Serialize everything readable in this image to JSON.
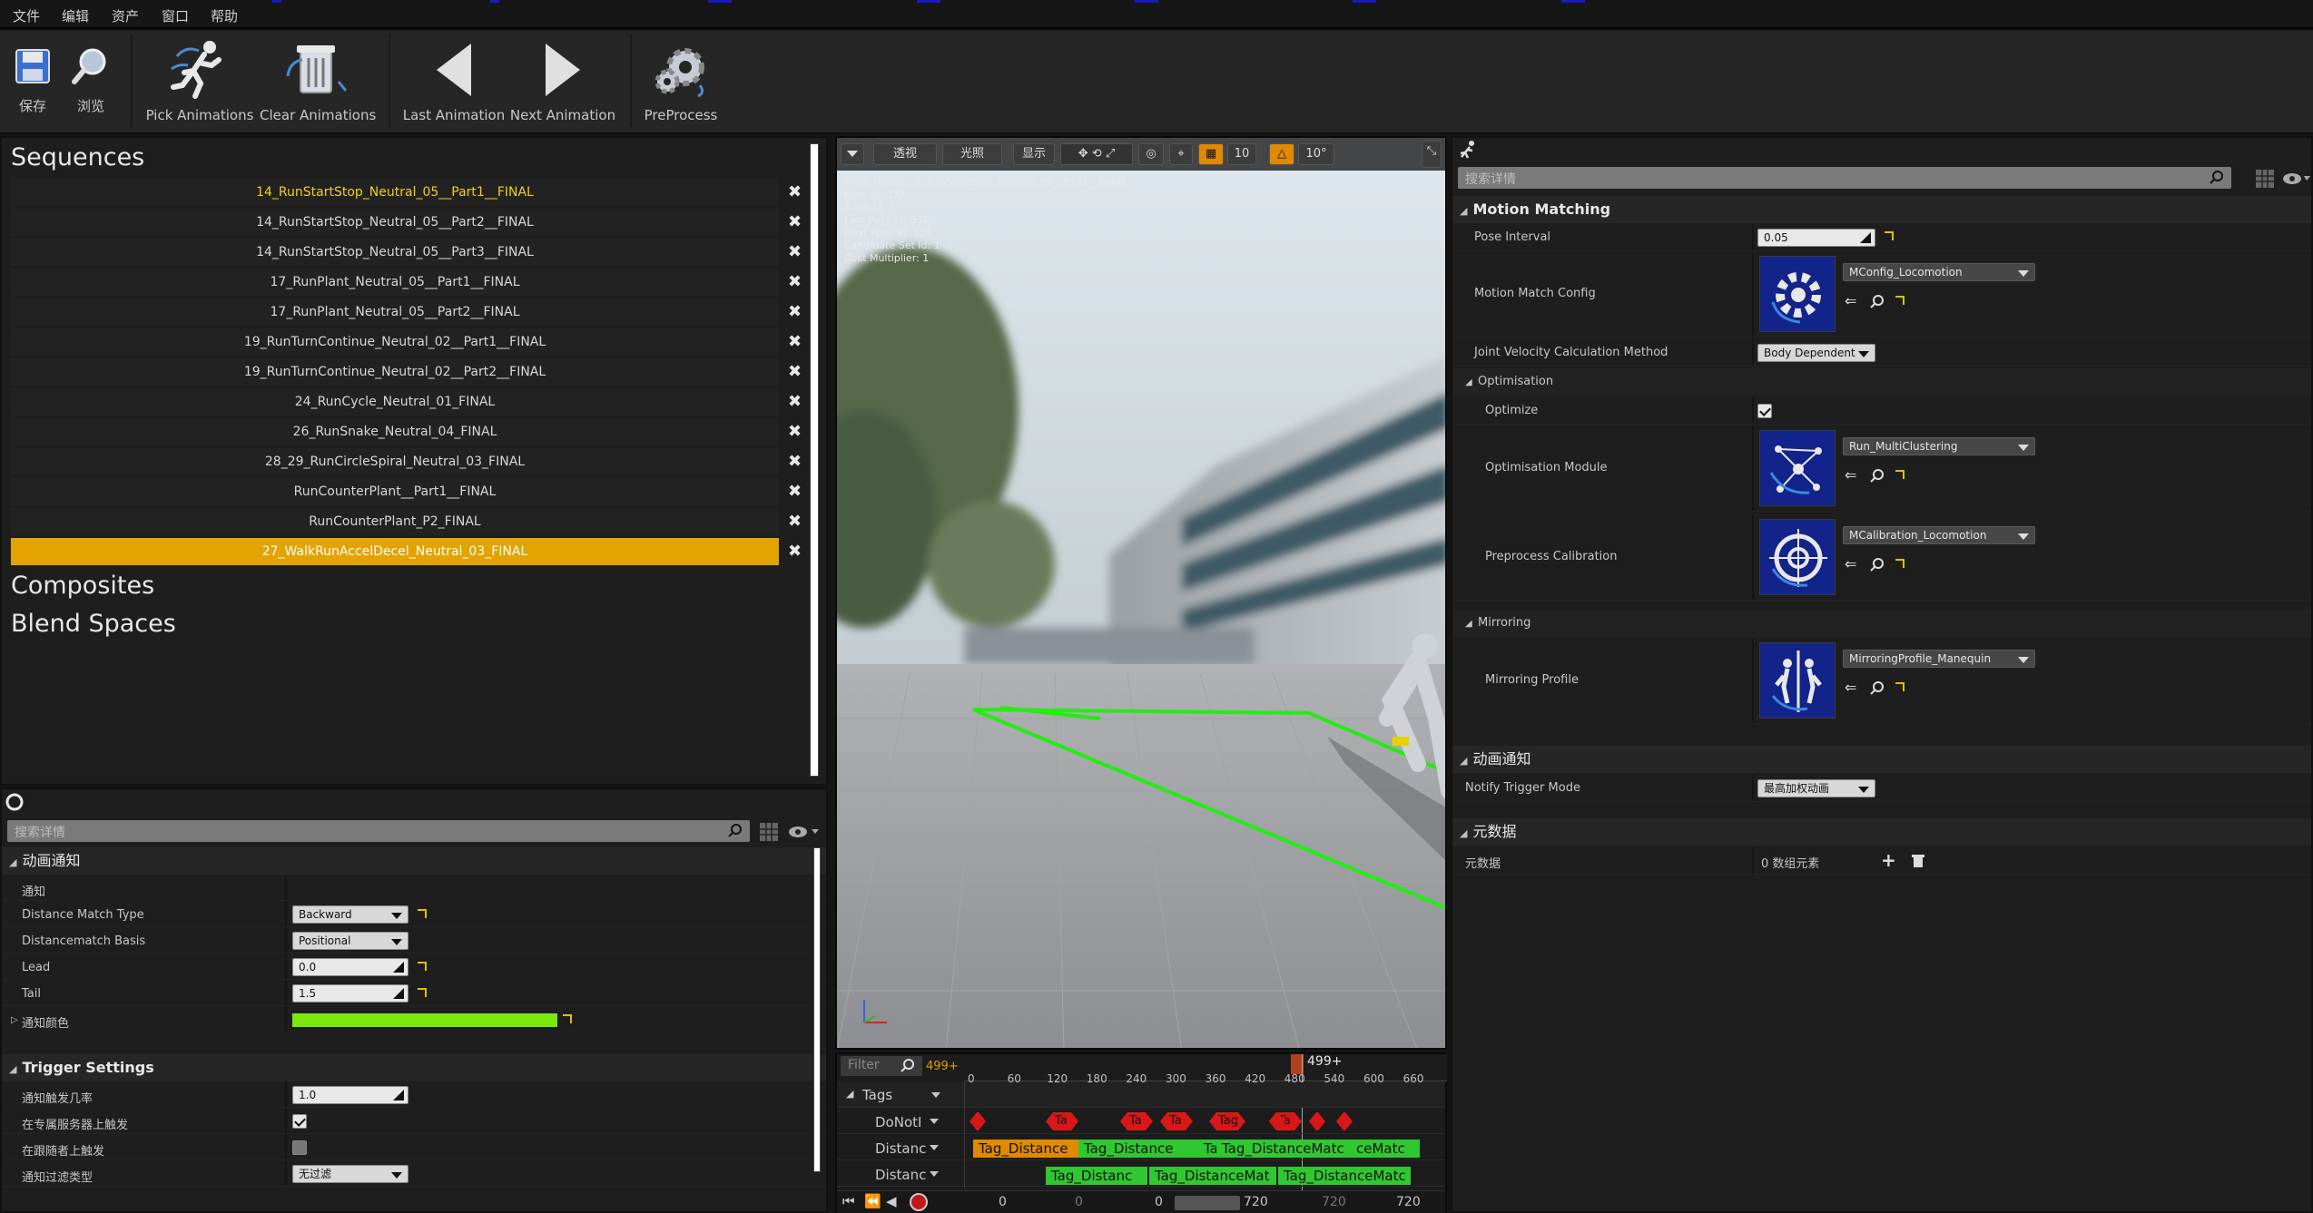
{
  "menu": [
    "文件",
    "编辑",
    "资产",
    "窗口",
    "帮助"
  ],
  "toolbar": {
    "save": "保存",
    "browse": "浏览",
    "pick": "Pick Animations",
    "clear": "Clear Animations",
    "last": "Last Animation",
    "next": "Next Animation",
    "preprocess": "PreProcess"
  },
  "sequences": {
    "title": "Sequences",
    "items": [
      "14_RunStartStop_Neutral_05__Part1__FINAL",
      "14_RunStartStop_Neutral_05__Part2__FINAL",
      "14_RunStartStop_Neutral_05__Part3__FINAL",
      "17_RunPlant_Neutral_05__Part1__FINAL",
      "17_RunPlant_Neutral_05__Part2__FINAL",
      "19_RunTurnContinue_Neutral_02__Part1__FINAL",
      "19_RunTurnContinue_Neutral_02__Part2__FINAL",
      "24_RunCycle_Neutral_01_FINAL",
      "26_RunSnake_Neutral_04_FINAL",
      "28_29_RunCircleSpiral_Neutral_03_FINAL",
      "RunCounterPlant__Part1__FINAL",
      "RunCounterPlant_P2_FINAL",
      "27_WalkRunAccelDecel_Neutral_03_FINAL"
    ],
    "remove_glyph": "✖",
    "composites": "Composites",
    "blend_spaces": "Blend Spaces"
  },
  "left_details": {
    "search_placeholder": "搜索详情",
    "section1": "动画通知",
    "notify_label": "通知",
    "distance_match_type_label": "Distance Match Type",
    "distance_match_type_value": "Backward",
    "distancematch_basis_label": "Distancematch Basis",
    "distancematch_basis_value": "Positional",
    "lead_label": "Lead",
    "lead_value": "0.0",
    "tail_label": "Tail",
    "tail_value": "1.5",
    "notify_color_label": "通知颜色",
    "notify_color": "#7aea0e",
    "section2": "Trigger Settings",
    "trigger_rate_label": "通知触发几率",
    "trigger_rate_value": "1.0",
    "dedicated_server_label": "在专属服务器上触发",
    "follower_label": "在跟随者上触发",
    "filter_type_label": "通知过滤类型",
    "filter_type_value": "无过滤"
  },
  "viewport": {
    "btn_perspective": "透视",
    "btn_lit": "光照",
    "btn_show": "显示",
    "grid_snap": "10",
    "rot_snap": "10°",
    "info": [
      "Anim Name: 14_RunStartStop_Neutral_05__Part1__FINAL",
      "Pose Id: 333",
      "Anim Id: 0",
      "Last Pose Id: 332",
      "Next Pose Id: 334",
      "Candidate Set Id: 1",
      "Cost Multiplier: 1"
    ]
  },
  "timeline": {
    "filter_placeholder": "Filter",
    "frame_total": "499+",
    "playhead": "499+",
    "ticks": [
      "0",
      "60",
      "120",
      "180",
      "240",
      "300",
      "360",
      "420",
      "480",
      "540",
      "600",
      "660"
    ],
    "tags_label": "Tags",
    "tracks": [
      "DoNotI",
      "Distanc",
      "Distanc"
    ],
    "red_tags": [
      "Ta",
      "Ta",
      "Ta",
      "Tag",
      "Ta"
    ],
    "row2_tags": [
      "Tag_Distance",
      "Tag_Distance",
      "Ta",
      "Tag_DistanceMatc",
      "ceMatc"
    ],
    "row3_tags": [
      "Tag_Distanc",
      "Tag_DistanceMat",
      "Tag_DistanceMatc"
    ],
    "bottom_nums": [
      "0",
      "0",
      "0",
      "720",
      "720",
      "720"
    ]
  },
  "right_details": {
    "search_placeholder": "搜索详情",
    "section_mm": "Motion Matching",
    "pose_interval_label": "Pose Interval",
    "pose_interval_value": "0.05",
    "mm_config_label": "Motion Match Config",
    "mm_config_value": "MConfig_Locomotion",
    "jvcm_label": "Joint Velocity Calculation Method",
    "jvcm_value": "Body Dependent",
    "sub_optimisation": "Optimisation",
    "optimize_label": "Optimize",
    "opt_module_label": "Optimisation Module",
    "opt_module_value": "Run_MultiClustering",
    "preprocess_cal_label": "Preprocess Calibration",
    "preprocess_cal_value": "MCalibration_Locomotion",
    "sub_mirroring": "Mirroring",
    "mirroring_profile_label": "Mirroring Profile",
    "mirroring_profile_value": "MirroringProfile_Manequin",
    "section_notify": "动画通知",
    "notify_trigger_mode_label": "Notify Trigger Mode",
    "notify_trigger_mode_value": "最高加权动画",
    "section_meta": "元数据",
    "meta_label": "元数据",
    "meta_value": "0 数组元素",
    "add_glyph": "+",
    "back_glyph": "⇐"
  },
  "colors": {
    "accent_selection": "#e3a300",
    "highlight_text": "#f0d020",
    "thumb_bg": "#12238a"
  }
}
